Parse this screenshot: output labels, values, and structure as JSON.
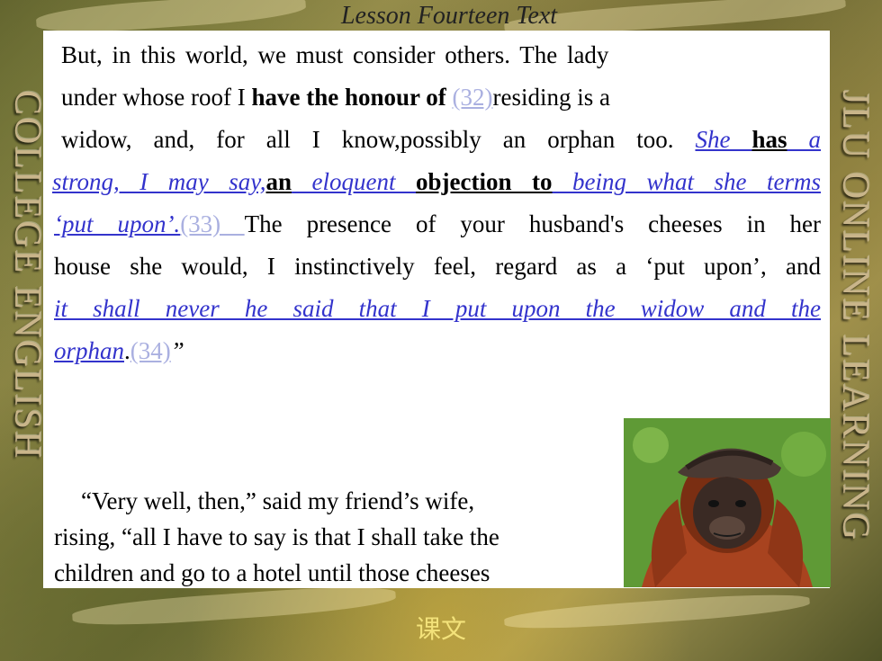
{
  "header": {
    "lesson_title": "Lesson Fourteen Text"
  },
  "side_titles": {
    "left": "COLLEGE ENGLISH",
    "right": "JLU ONLINE LEARNING"
  },
  "paragraph1": {
    "l1": "But, in this world, we must consider others. The lady",
    "l2_a": "under whose roof I ",
    "l2_bold": "have the honour of",
    "l2_num": "(32)",
    "l2_b": "residing is a",
    "l3_a": "widow, and, for all I know,possibly an orphan too. ",
    "l3_she": "She ",
    "l3_has": "has",
    "l3_a2": " a",
    "l4_strong": "strong, I may say,",
    "l4_an": "an",
    "l4_eloquent": " eloquent ",
    "l4_objection": "objection to",
    "l4_being": " being what she terms",
    "l5_put": "‘put upon’.",
    "l5_num": "(33) ",
    "l5_rest": "The presence of your husband's cheeses in her",
    "l6": "house she would, I instinctively feel, regard as a ‘put upon’, and",
    "l7": "it shall never he said that I put upon the widow and the",
    "l8_orphan": "orphan",
    "l8_dot": ".",
    "l8_num": "(34)",
    "l8_quote": "”"
  },
  "paragraph2": {
    "l1": "“Very well, then,” said my friend’s wife,",
    "l2": "rising, “all I have to say is that I shall take the",
    "l3": "children and go to a hotel until those cheeses"
  },
  "footer": {
    "caption": "课文"
  },
  "image": {
    "subject": "orangutan-photo"
  }
}
